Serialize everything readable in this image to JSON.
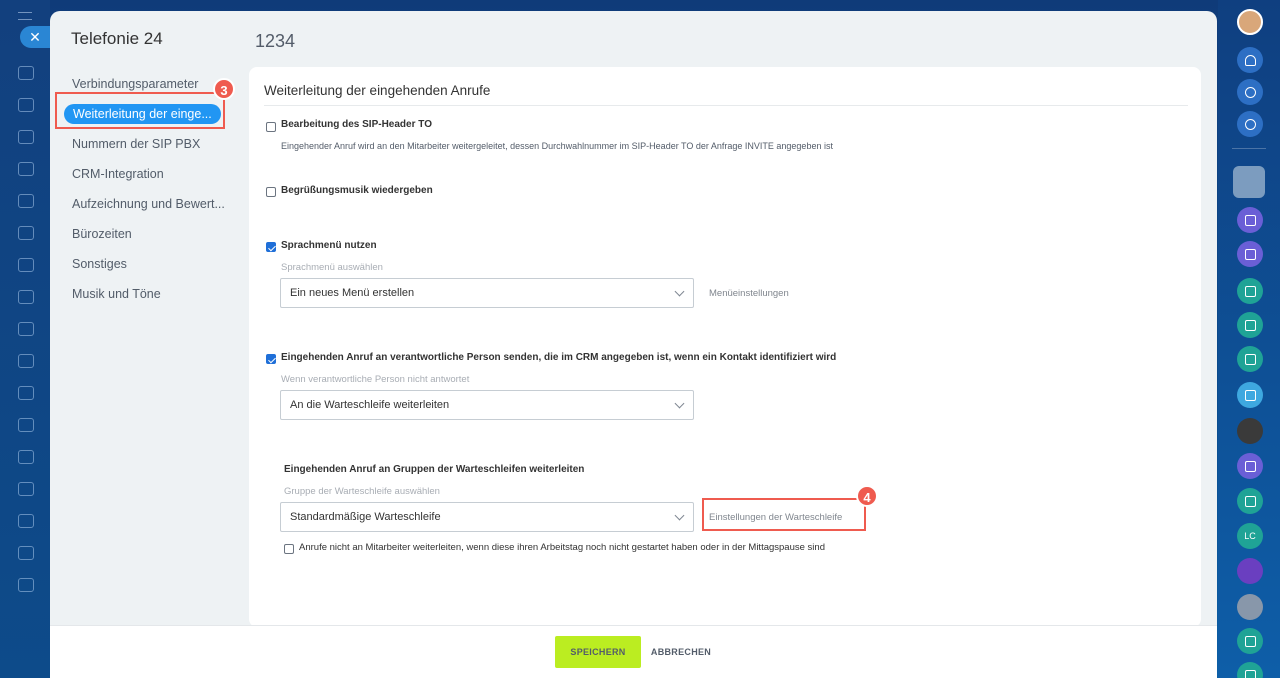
{
  "app": {
    "title": "Telefonie 24",
    "line_name": "1234"
  },
  "sidenav": {
    "items": [
      {
        "label": "Verbindungsparameter"
      },
      {
        "label": "Weiterleitung der einge..."
      },
      {
        "label": "Nummern der SIP PBX"
      },
      {
        "label": "CRM-Integration"
      },
      {
        "label": "Aufzeichnung und Bewert..."
      },
      {
        "label": "Bürozeiten"
      },
      {
        "label": "Sonstiges"
      },
      {
        "label": "Musik und Töne"
      }
    ],
    "active_index": 1
  },
  "badges": {
    "step3": "3",
    "step4": "4"
  },
  "section": {
    "title": "Weiterleitung der eingehenden Anrufe",
    "sip_header": {
      "label": "Bearbeitung des SIP-Header TO",
      "checked": false,
      "description": "Eingehender Anruf wird an den Mitarbeiter weitergeleitet, dessen Durchwahlnummer im SIP-Header TO der Anfrage INVITE angegeben ist"
    },
    "greeting": {
      "label": "Begrüßungsmusik wiedergeben",
      "checked": false
    },
    "ivr": {
      "label": "Sprachmenü nutzen",
      "checked": true,
      "select_hint": "Sprachmenü auswählen",
      "select_value": "Ein neues Menü erstellen",
      "settings_link": "Menüeinstellungen"
    },
    "crm": {
      "label": "Eingehenden Anruf an verantwortliche Person senden, die im CRM angegeben ist, wenn ein Kontakt identifiziert wird",
      "checked": true,
      "select_hint": "Wenn verantwortliche Person nicht antwortet",
      "select_value": "An die Warteschleife weiterleiten"
    },
    "queue": {
      "label": "Eingehenden Anruf an Gruppen der Warteschleifen weiterleiten",
      "select_hint": "Gruppe der Warteschleife auswählen",
      "select_value": "Standardmäßige Warteschleife",
      "settings_link": "Einstellungen der Warteschleife",
      "skip_label": "Anrufe nicht an Mitarbeiter weiterleiten, wenn diese ihren Arbeitstag noch nicht gestartet haben oder in der Mittagspause sind",
      "skip_checked": false
    }
  },
  "footer": {
    "save": "SPEICHERN",
    "cancel": "ABBRECHEN"
  },
  "rightbar": {
    "lc_avatar": "LC"
  },
  "colors": {
    "accent": "#2196f3",
    "save": "#bbed21",
    "highlight": "#ef5b4f",
    "checkbox": "#1f6fd8"
  }
}
